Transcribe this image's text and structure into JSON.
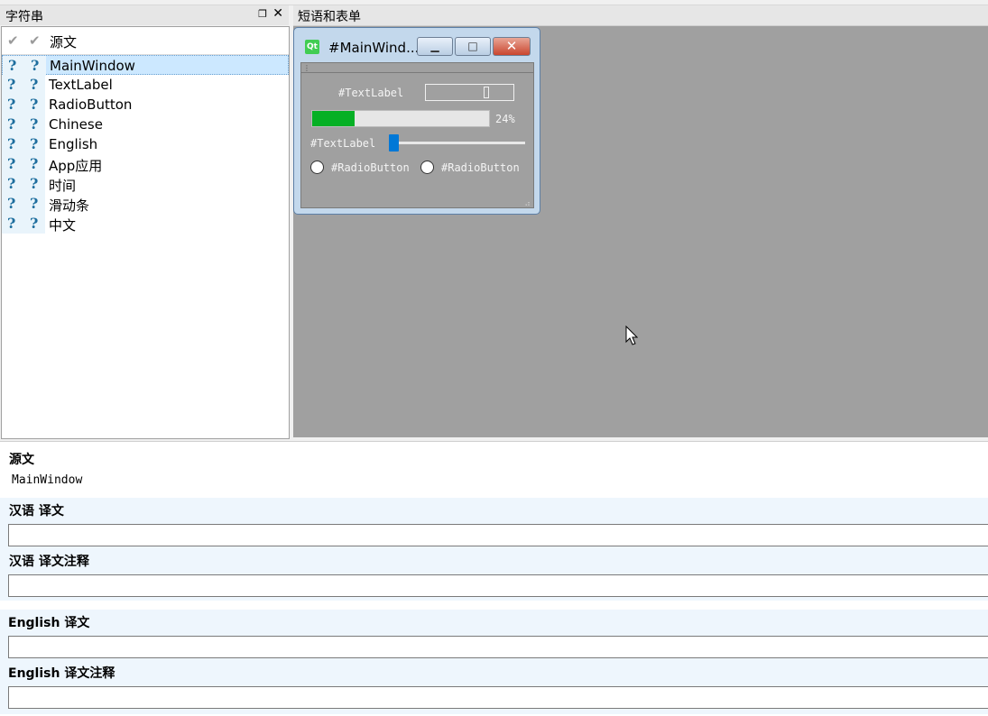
{
  "strings_dock": {
    "title": "字符串",
    "float_icon": "❐",
    "close_icon": "✕",
    "header": {
      "source_label": "源文"
    },
    "items": [
      {
        "label": "MainWindow",
        "selected": true
      },
      {
        "label": "TextLabel"
      },
      {
        "label": "RadioButton"
      },
      {
        "label": "Chinese"
      },
      {
        "label": "English"
      },
      {
        "label": "App应用"
      },
      {
        "label": "时间"
      },
      {
        "label": "滑动条"
      },
      {
        "label": "中文"
      }
    ]
  },
  "forms_dock": {
    "title": "短语和表单"
  },
  "preview": {
    "window_title": "#MainWind...",
    "logo_text": "Qt",
    "min_glyph": "▁",
    "max_glyph": "□",
    "close_glyph": "✕",
    "label1": "#TextLabel",
    "progress_value": 24,
    "progress_text": "24%",
    "label2": "#TextLabel",
    "slider_value": 0,
    "radio1": "#RadioButton",
    "radio2": "#RadioButton"
  },
  "editor": {
    "source_heading": "源文",
    "source_text": "MainWindow",
    "sections": [
      {
        "heading": "汉语 译文"
      },
      {
        "heading": "汉语 译文注释"
      },
      {
        "heading": "English 译文"
      },
      {
        "heading": "English 译文注释"
      }
    ]
  },
  "colors": {
    "progress_fill": "#06b025",
    "slider_handle": "#0078d7",
    "selection": "#cce8ff",
    "canvas": "#a0a0a0"
  }
}
